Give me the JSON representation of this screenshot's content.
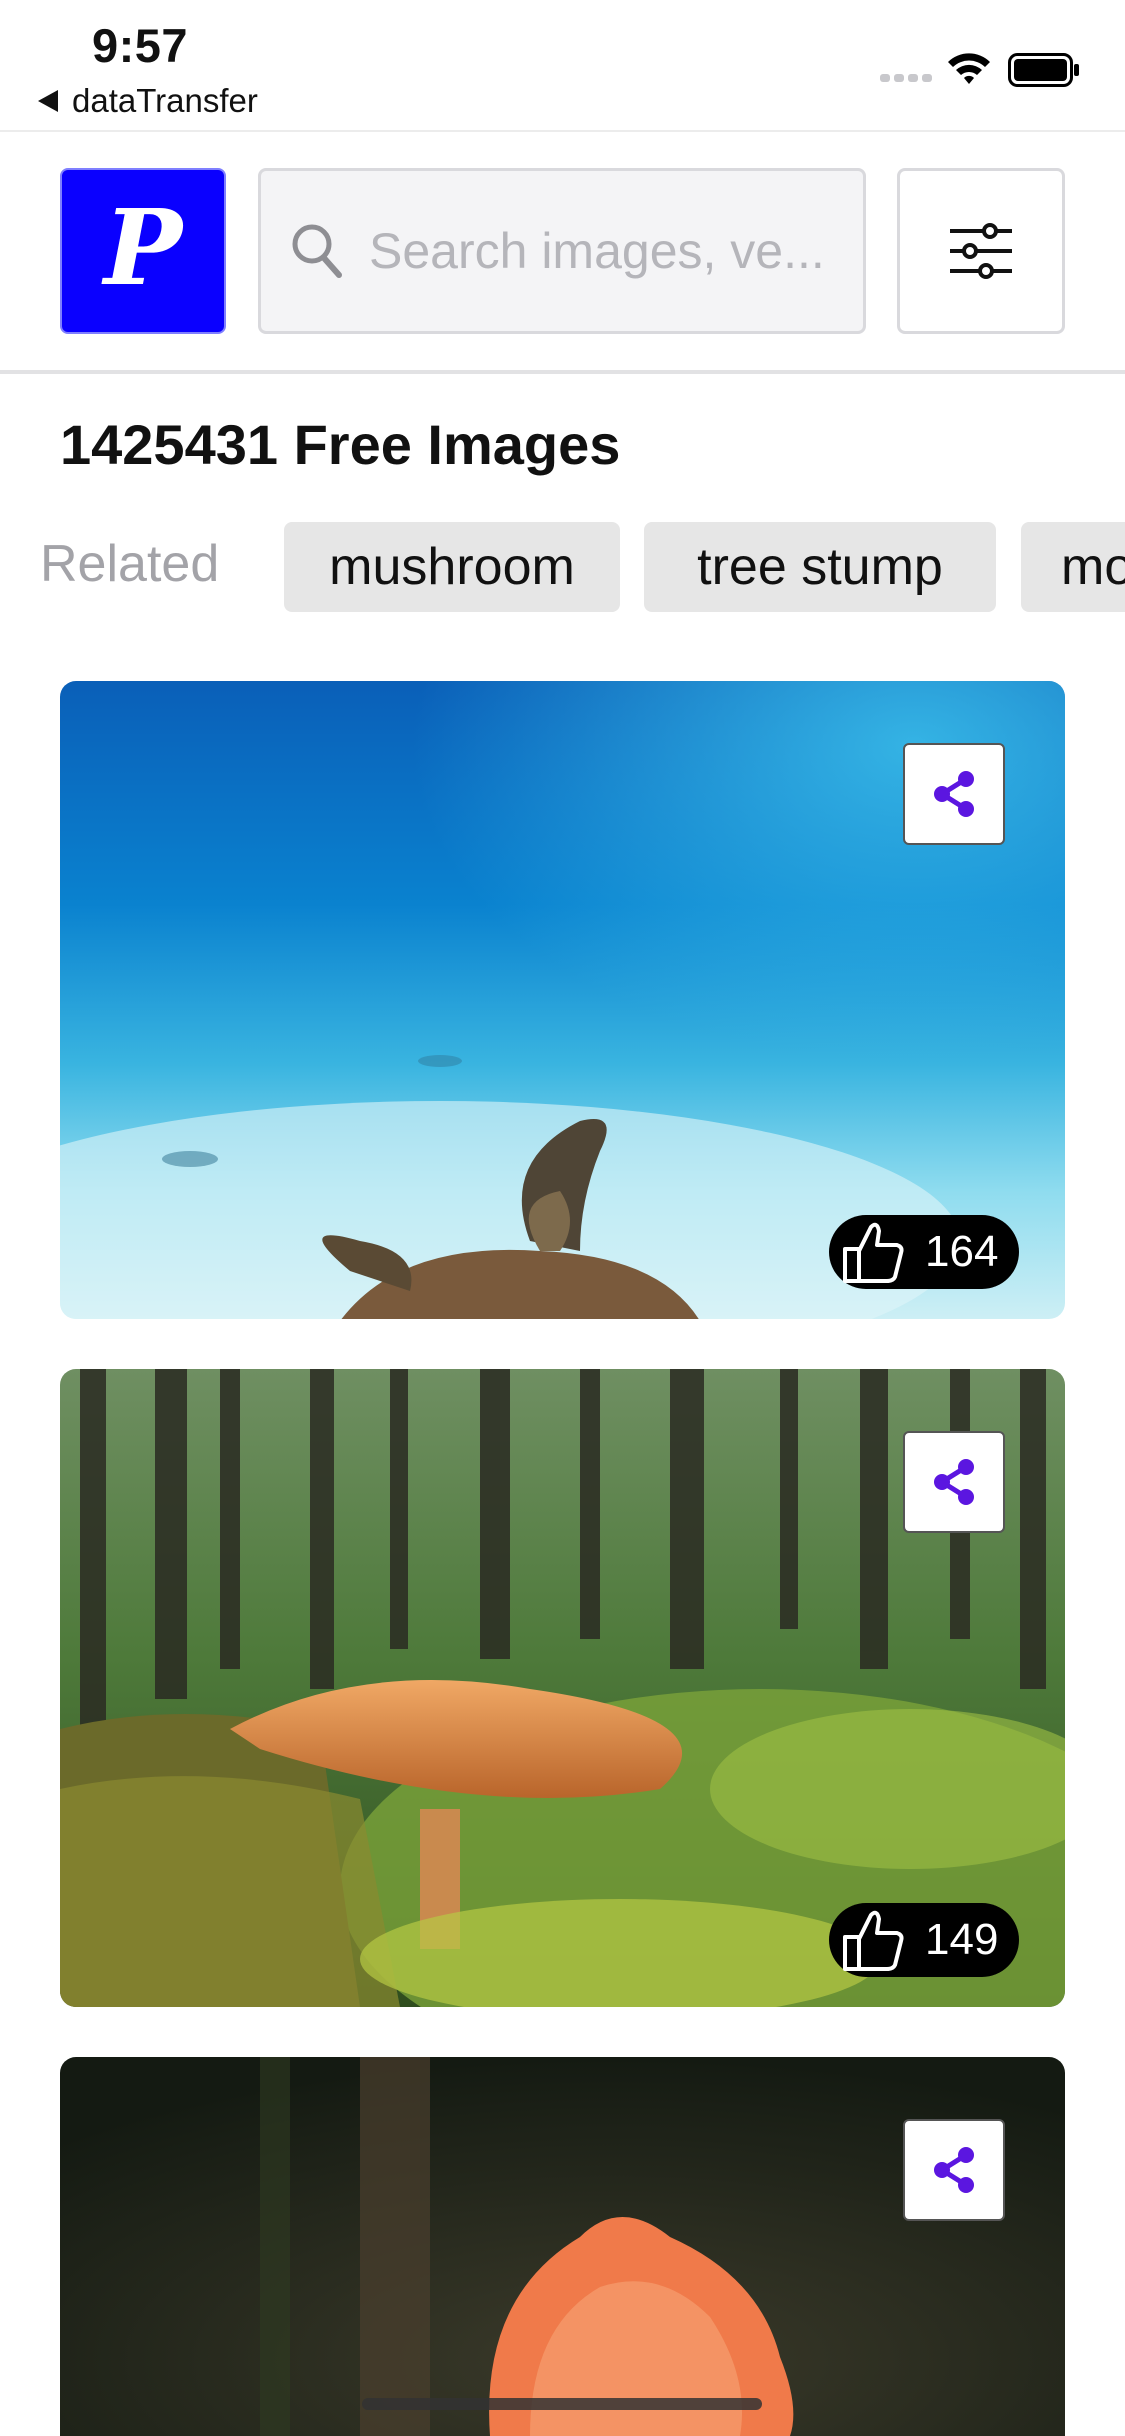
{
  "status_bar": {
    "time": "9:57",
    "back_app_label": "dataTransfer",
    "icons": [
      "signal-icon",
      "wifi-icon",
      "battery-icon"
    ]
  },
  "header": {
    "logo_letter": "P",
    "logo_color": "#0a00ff",
    "search_placeholder": "Search images, ve...",
    "search_value": "",
    "filter_icon": "sliders-icon"
  },
  "results": {
    "title": "1425431 Free Images"
  },
  "related": {
    "label": "Related",
    "tags": [
      "mushroom",
      "tree stump",
      "mo"
    ]
  },
  "cards": [
    {
      "image": "sea-turtle-underwater",
      "likes": "164",
      "share_icon": "share-icon",
      "like_icon": "thumbs-up-icon"
    },
    {
      "image": "mushroom-on-mossy-stump-forest",
      "likes": "149",
      "share_icon": "share-icon",
      "like_icon": "thumbs-up-icon"
    },
    {
      "image": "orange-flower-dark-background",
      "share_icon": "share-icon"
    }
  ],
  "colors": {
    "accent_share": "#5b16e0",
    "chip_bg": "#e6e6e6",
    "muted_text": "#a3a3a8"
  }
}
